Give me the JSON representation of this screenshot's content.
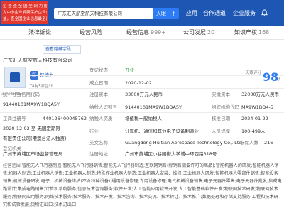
{
  "header": {
    "banner_lines": [
      "企 查 查 全 国 全 网 为 国 企 企",
      "为中小企业发展保护企业合法权",
      "益，查全国企业信息最全面"
    ],
    "search_value": "广东汇天航空航天科技有限公司",
    "search_button": "天眼一下",
    "nav": [
      "应用",
      "合作通道",
      "企业服务"
    ]
  },
  "tabs": [
    {
      "label": "法律诉讼",
      "count": ""
    },
    {
      "label": "经营风险",
      "count": ""
    },
    {
      "label": "经营信息",
      "count": "999+"
    },
    {
      "label": "公司发展",
      "count": "20"
    },
    {
      "label": "知识产权",
      "count": "168"
    }
  ],
  "card": {
    "hide_button": "查看隐藏字段",
    "company_name": "广东汇天航空航天科技有限公司",
    "logo_text": "汇天HuiTian",
    "legal_rep": {
      "avatar": "赵",
      "name": "赵德力",
      "label": "TA有5家企业"
    },
    "status_label": "登记状态",
    "status": "开业",
    "date_label": "成立日期",
    "date": "2020-12-02",
    "capital_label": "注册资本",
    "capital": "33000万元人民币",
    "paid_label": "实缴资本",
    "paid": "32000万元人民币",
    "credit_code_label": "统一社会信用代码",
    "credit_code": "91440101MA9W1BQA5Y",
    "tax_label": "纳税人识别号",
    "tax_id": "91440101MA9W1BQA5Y",
    "reg_no_label": "工商注册号",
    "reg_no": "440126400045762",
    "org_code_label": "组织机构代码",
    "org_code": "MA9W1BQ4-5",
    "term_label": "营业期限",
    "term": "2020-12-02 至 无固定期限",
    "taxpayer_label": "纳税人资质",
    "taxpayer": "增值税一般纳税人",
    "verify_label": "核准日期",
    "verify": "2024-01-22",
    "type_label": "企业类型",
    "type": "有限责任公司(港澳台法人独资)",
    "industry_label": "行业",
    "industry": "计算机、通信和其他电子设备制造业",
    "staff_label": "人员规模",
    "staff": "100-499人",
    "insured_label": "参保人数",
    "insured": "216",
    "en_label": "英文名称",
    "en": "Guangdong Huitian Aerospace Technology Co., Ltd",
    "authority_label": "登记机关",
    "authority": "广州市黄埔区市场监督管理局",
    "address_label": "注册地址",
    "address": "广州市黄埔区小谷围街大学城中环西路318号",
    "scope_label": "经营范围",
    "scope": "智能无人飞行器制造;智能无人飞行器销售;智能无人飞行器制造;互联网销售(除销售需要许可的商品);智能机器人的研发;智能机器人销售;机器人制造;工业机器人销售;工业机器人制造;特殊作业机器人制造;工业机器人安装、维修;工业机器人研发;智能机器人零部件销售;智能设备销售;机械设备研发;电子、机械设备维护(不含特种设备);通用设备修理;专用设备修理;电气机械设备销售;电子元器件零售;电子元器件批发;集成电路设计;集成电路销售;计算机系统服务;信息技术咨询服务;软件开发;人工智能应用软件开发;人工智能基础软件开发;物联网技术研发;物联网技术服务;物联网应用服务;网络技术服务;技术服务、技术开发、技术咨询、技术交流、技术转让、技术推广;数据处理和存储支持服务;工程和技术研究和试验发展;货物进出口;技术进出口"
  },
  "score": {
    "label": "天眼评分",
    "value": "98",
    "unit": "分"
  }
}
